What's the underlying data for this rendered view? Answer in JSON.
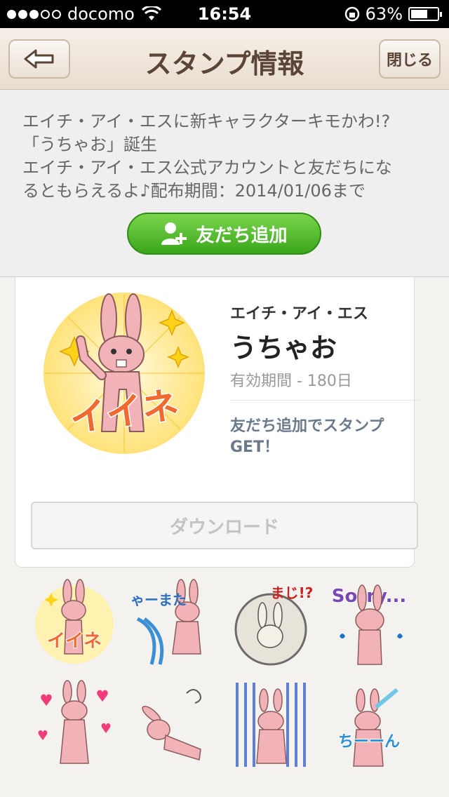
{
  "status_bar": {
    "carrier": "docomo",
    "time": "16:54",
    "battery": "63%",
    "battery_level": 0.63
  },
  "nav": {
    "title": "スタンプ情報",
    "close_label": "閉じる",
    "back_icon": "back-arrow-icon"
  },
  "info": {
    "description_lines": [
      "エイチ・アイ・エスに新キャラクターキモかわ!?",
      "「うちゃお」誕生",
      "エイチ・アイ・エス公式アカウントと友だちにな",
      "るともらえるよ♪配布期間：2014/01/06まで"
    ],
    "add_friend_label": "友だち追加"
  },
  "sticker": {
    "publisher": "エイチ・アイ・エス",
    "name": "うちゃお",
    "validity": "有効期間 - 180日",
    "promo": "友だち追加でスタンプGET！",
    "download_label": "ダウンロード",
    "main_caption": "イイネ"
  },
  "sticker_grid": [
    {
      "caption": "イイネ",
      "kind": "thumbs-up"
    },
    {
      "caption": "じゃーまた",
      "kind": "waterfall"
    },
    {
      "caption": "まじ!?",
      "kind": "shocked"
    },
    {
      "caption": "Sorry...",
      "kind": "sorry"
    },
    {
      "caption": "",
      "kind": "hearts"
    },
    {
      "caption": "",
      "kind": "lying"
    },
    {
      "caption": "",
      "kind": "crying"
    },
    {
      "caption": "ちーーん",
      "kind": "sitting"
    }
  ],
  "colors": {
    "nav_title": "#5b4537",
    "add_button": "#3aa71c",
    "bunny_pink": "#f2b3b8",
    "promo_text": "#6b7a8b"
  }
}
